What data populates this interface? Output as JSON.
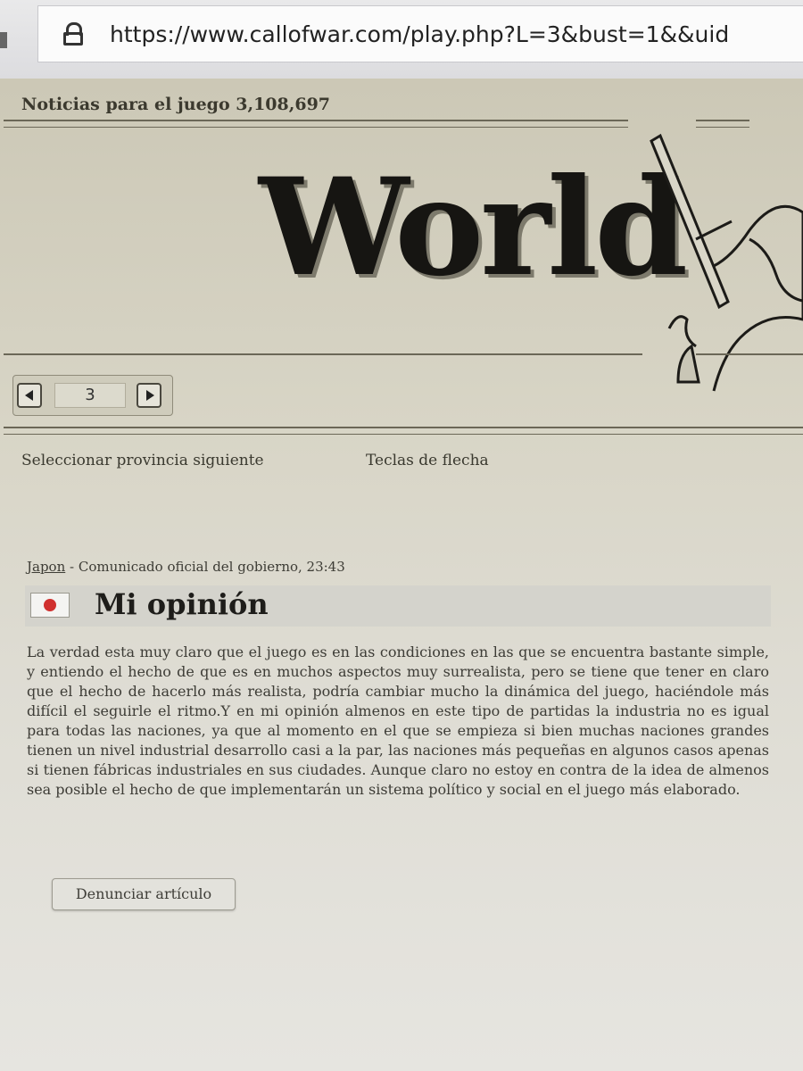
{
  "browser": {
    "url": "https://www.callofwar.com/play.php?L=3&bust=1&&uid"
  },
  "header": {
    "news_title": "Noticias para el juego 3,108,697",
    "masthead": "World"
  },
  "pager": {
    "current_page": "3"
  },
  "hints": {
    "action": "Seleccionar provincia siguiente",
    "keys": "Teclas de flecha"
  },
  "article": {
    "country": "Japon",
    "meta_rest": " - Comunicado oficial del gobierno, 23:43",
    "title": "Mi opinión",
    "body": "La verdad esta muy claro que el juego es en las condiciones en las que se encuentra bastante simple, y entiendo el hecho de que es en muchos aspectos muy surrealista, pero se tiene que tener en claro que el hecho de hacerlo más realista, podría cambiar mucho la dinámica del juego, haciéndole más difícil el seguirle el ritmo.Y en mi opinión almenos en este tipo de partidas la industria no es igual para todas las naciones, ya que al momento en el que se empieza si bien muchas naciones grandes tienen un nivel industrial desarrollo casi a la par, las naciones más pequeñas en algunos casos apenas si tienen fábricas industriales en sus ciudades. Aunque claro no estoy en contra de la idea de almenos sea posible el hecho de que implementarán un sistema político y social en el juego más elaborado.",
    "report_label": "Denunciar artículo"
  }
}
